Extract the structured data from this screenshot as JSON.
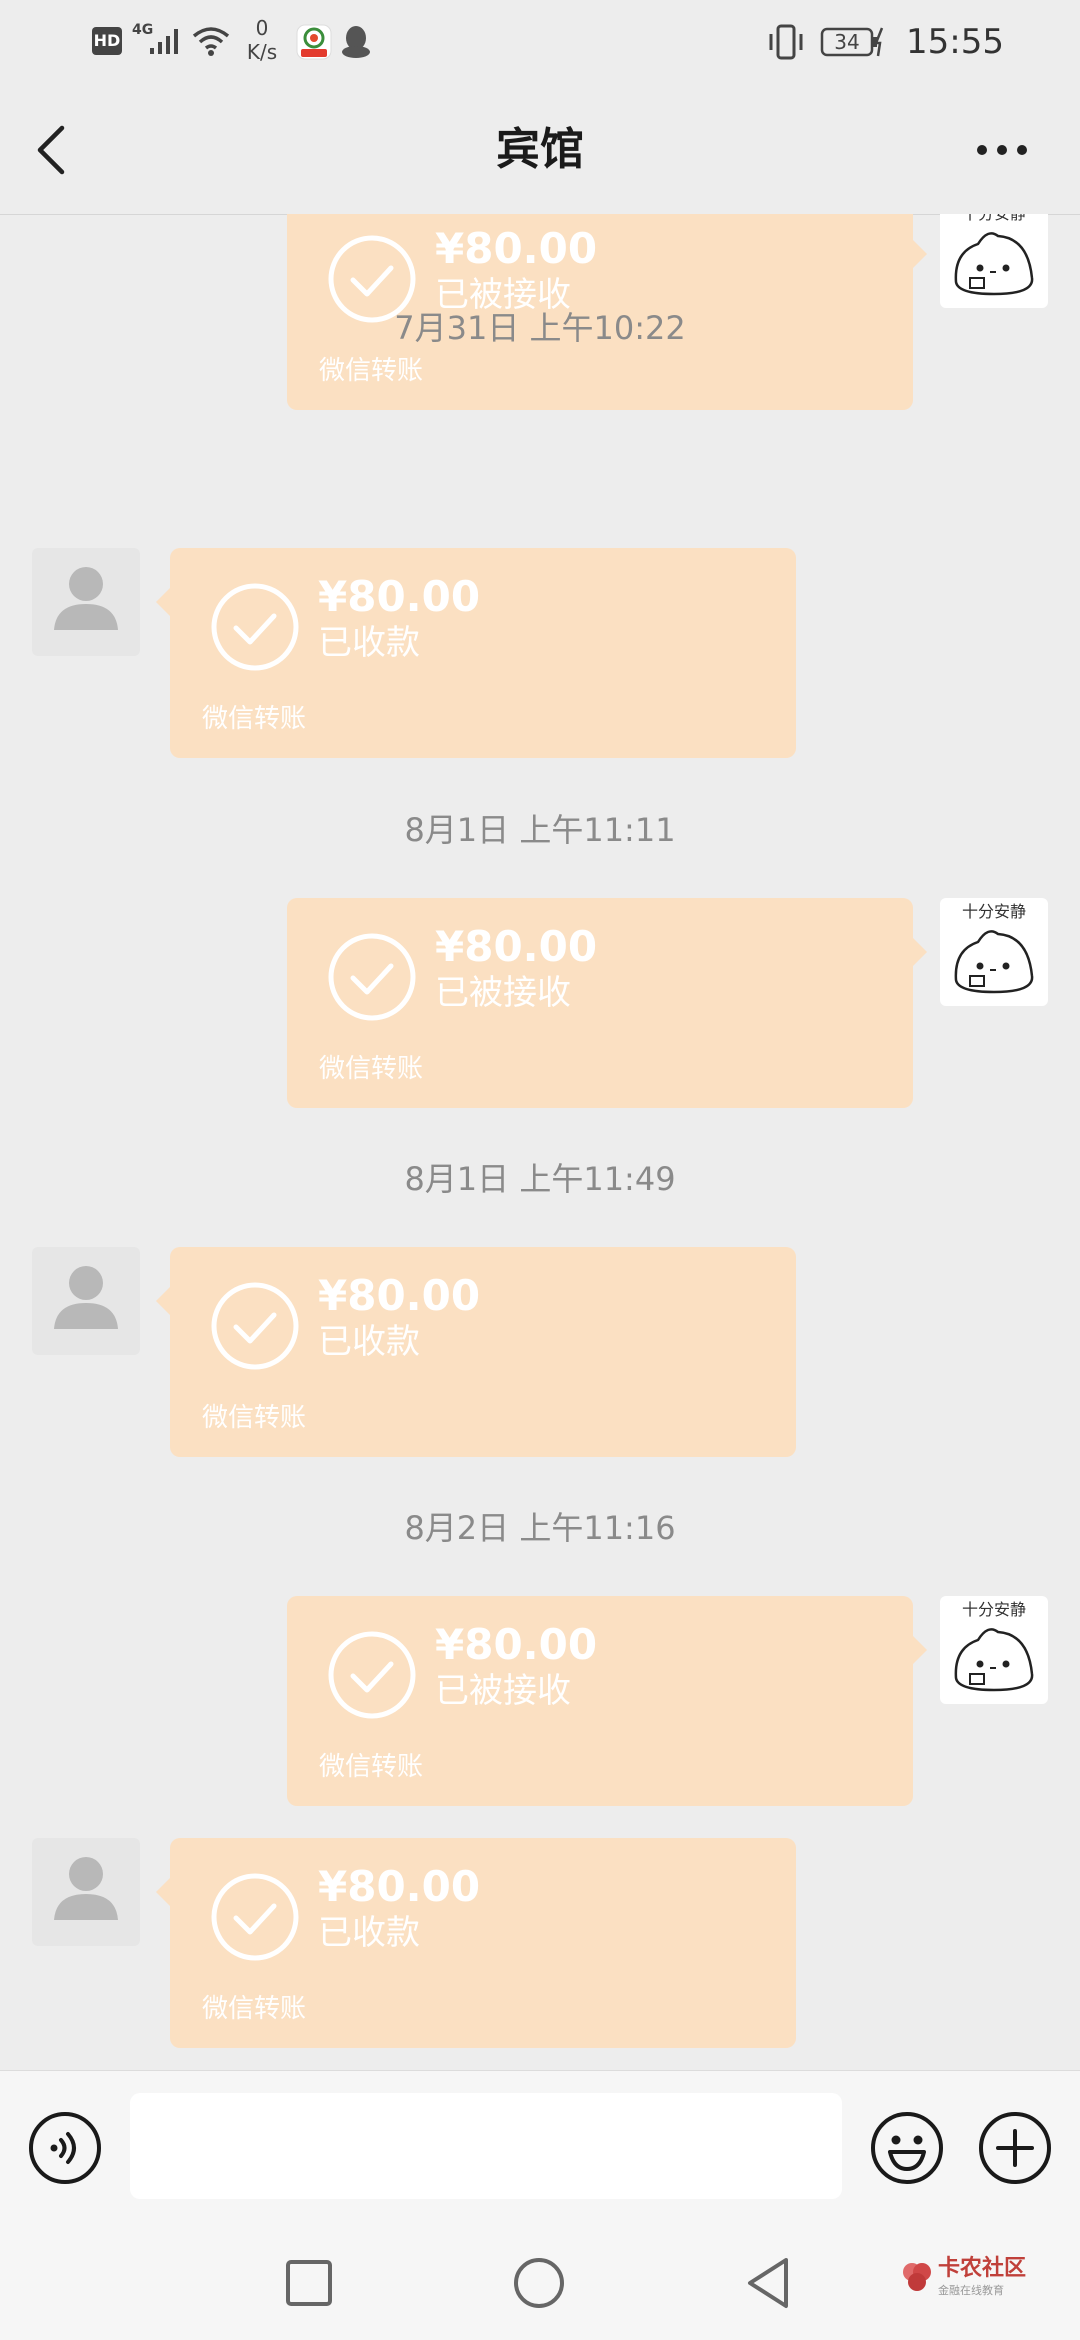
{
  "status_bar": {
    "hd_label": "HD",
    "network": "4G",
    "speed_value": "0",
    "speed_unit": "K/s",
    "battery": "34",
    "time": "15:55"
  },
  "header": {
    "title": "宾馆"
  },
  "avatar_caption": "十分安静",
  "messages": [
    {
      "amount": "¥80.00",
      "status": "已被接收",
      "footer": "微信转账"
    },
    {
      "amount": "¥80.00",
      "status": "已收款",
      "footer": "微信转账"
    },
    {
      "amount": "¥80.00",
      "status": "已被接收",
      "footer": "微信转账"
    },
    {
      "amount": "¥80.00",
      "status": "已收款",
      "footer": "微信转账"
    },
    {
      "amount": "¥80.00",
      "status": "已被接收",
      "footer": "微信转账"
    },
    {
      "amount": "¥80.00",
      "status": "已收款",
      "footer": "微信转账"
    }
  ],
  "timestamps": [
    "7月31日 上午10:22",
    "8月1日 上午11:11",
    "8月1日 上午11:49",
    "8月2日 上午11:16"
  ],
  "input": {
    "value": ""
  },
  "watermark": {
    "title": "卡农社区",
    "subtitle": "金融在线教育"
  },
  "colors": {
    "transfer_bubble": "#fbe0c2",
    "background": "#ededed"
  }
}
